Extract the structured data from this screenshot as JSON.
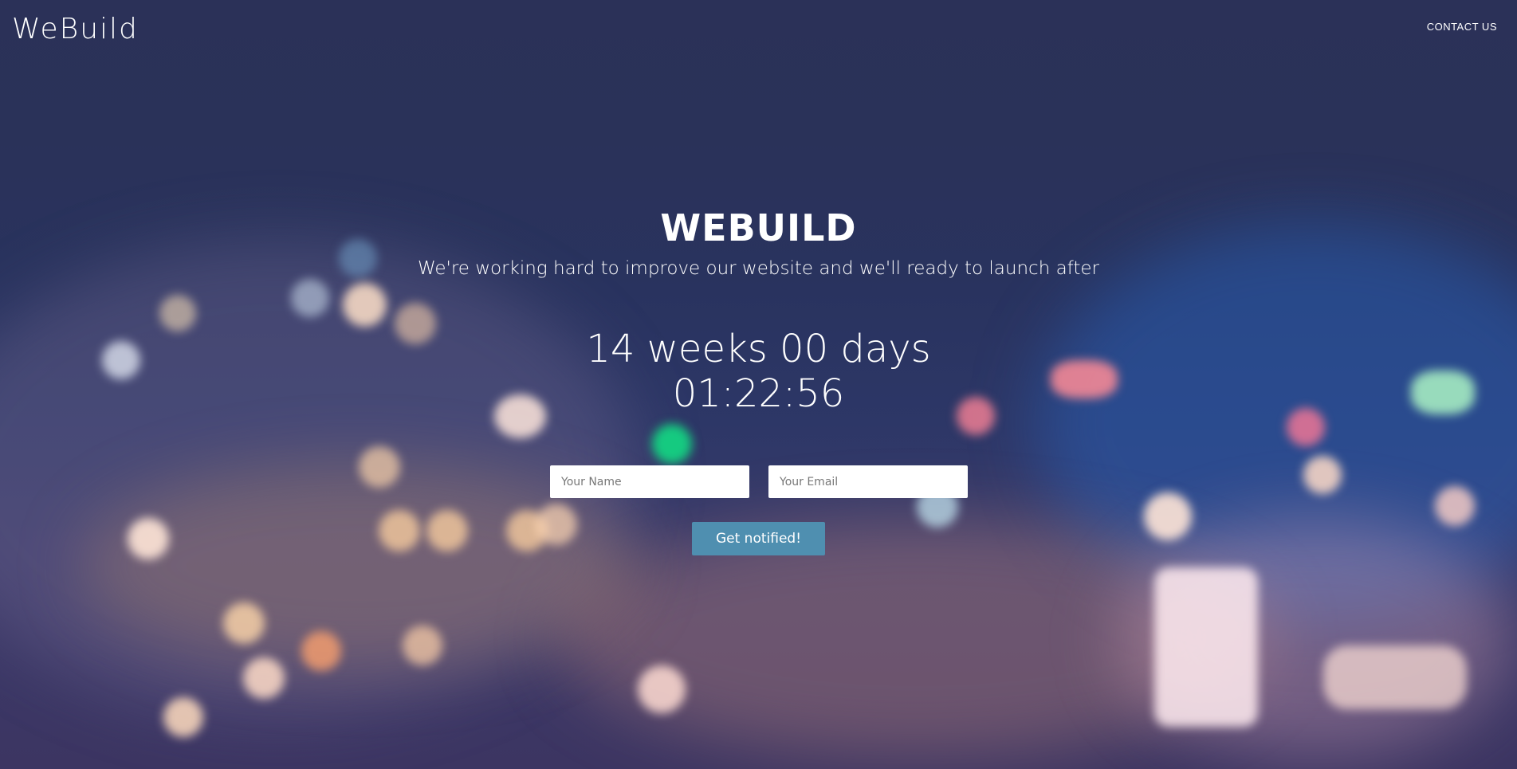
{
  "header": {
    "logo": "WeBuild",
    "contact_label": "CONTACT US"
  },
  "hero": {
    "title": "WEBUILD",
    "subtitle": "We're working hard to improve our website and we'll ready to launch after"
  },
  "countdown": {
    "line1": "14 weeks 00 days",
    "line2": "01:22:56"
  },
  "form": {
    "name_placeholder": "Your Name",
    "email_placeholder": "Your Email",
    "submit_label": "Get notified!"
  },
  "colors": {
    "background": "#2a3157",
    "button": "#4f8fb0",
    "text": "#ffffff"
  }
}
